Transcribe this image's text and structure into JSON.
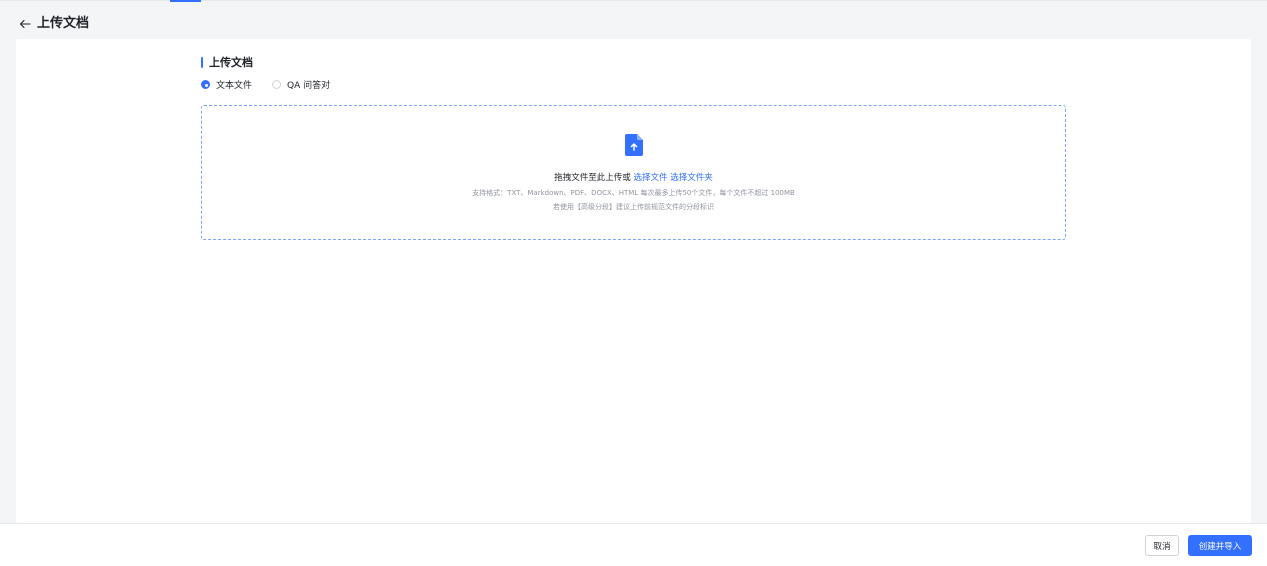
{
  "header": {
    "back_icon": "arrow-left-icon",
    "title": "上传文档"
  },
  "section": {
    "title": "上传文档"
  },
  "radios": [
    {
      "label": "文本文件",
      "checked": true
    },
    {
      "label": "QA 问答对",
      "checked": false
    }
  ],
  "dropzone": {
    "icon": "file-upload-icon",
    "main_text": "拖拽文件至此上传或",
    "link_file": "选择文件",
    "link_folder": "选择文件夹",
    "hint_formats": "支持格式：TXT、Markdown、PDF、DOCX、HTML 每次最多上传50个文件，每个文件不超过 100MB",
    "hint_segment": "若使用【高级分段】建议上传前规范文件的分段标识"
  },
  "footer": {
    "cancel_label": "取消",
    "submit_label": "创建并导入"
  },
  "colors": {
    "accent": "#3370ff",
    "background": "#f4f5f7",
    "card": "#ffffff",
    "hint_text": "#8f959e"
  }
}
